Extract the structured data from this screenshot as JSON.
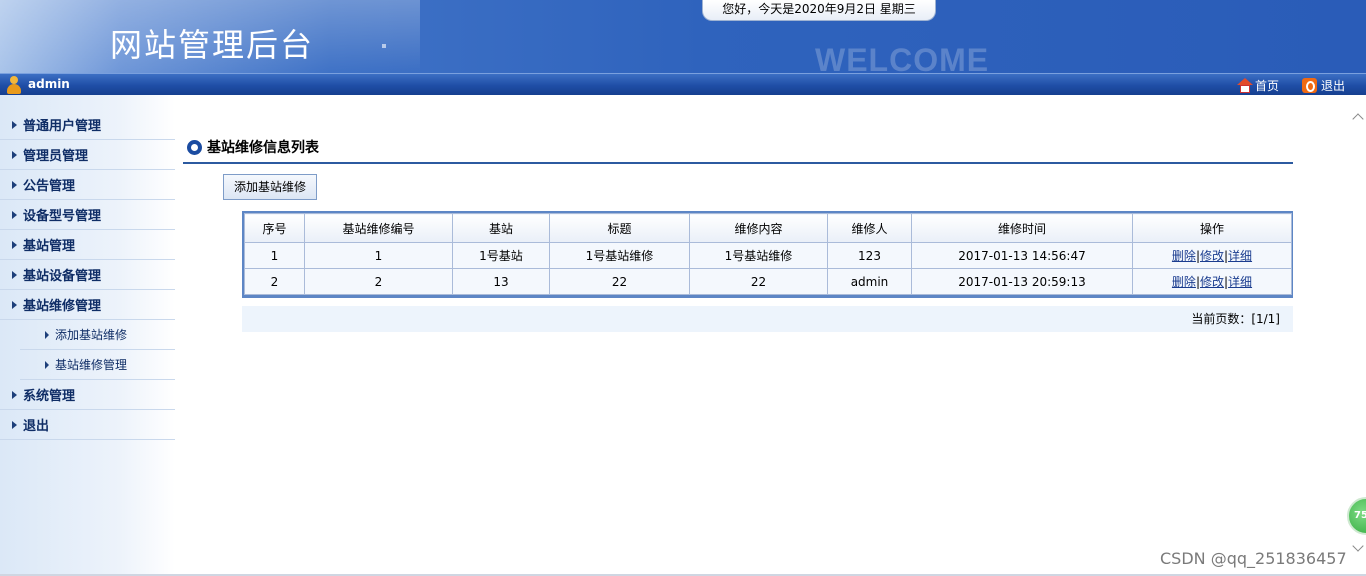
{
  "header": {
    "site_title": "网站管理后台",
    "watermark": "WELCOME",
    "date_text": "您好，今天是2020年9月2日 星期三"
  },
  "userbar": {
    "username": "admin",
    "home_label": "首页",
    "logout_label": "退出"
  },
  "sidebar": {
    "items": [
      {
        "label": "普通用户管理"
      },
      {
        "label": "管理员管理"
      },
      {
        "label": "公告管理"
      },
      {
        "label": "设备型号管理"
      },
      {
        "label": "基站管理"
      },
      {
        "label": "基站设备管理"
      },
      {
        "label": "基站维修管理"
      },
      {
        "label": "系统管理"
      },
      {
        "label": "退出"
      }
    ],
    "subitems": [
      {
        "label": "添加基站维修"
      },
      {
        "label": "基站维修管理"
      }
    ]
  },
  "main": {
    "section_title": "基站维修信息列表",
    "add_button": "添加基站维修",
    "table": {
      "headers": [
        "序号",
        "基站维修编号",
        "基站",
        "标题",
        "维修内容",
        "维修人",
        "维修时间",
        "操作"
      ],
      "rows": [
        [
          "1",
          "1",
          "1号基站",
          "1号基站维修",
          "1号基站维修",
          "123",
          "2017-01-13 14:56:47"
        ],
        [
          "2",
          "2",
          "13",
          "22",
          "22",
          "admin",
          "2017-01-13 20:59:13"
        ]
      ],
      "actions": {
        "delete": "删除",
        "sep": "|",
        "edit": "修改",
        "detail": "详细"
      }
    },
    "pager": "当前页数：[1/1]"
  },
  "overlay": {
    "badge": "75",
    "watermark": "CSDN @qq_251836457"
  }
}
